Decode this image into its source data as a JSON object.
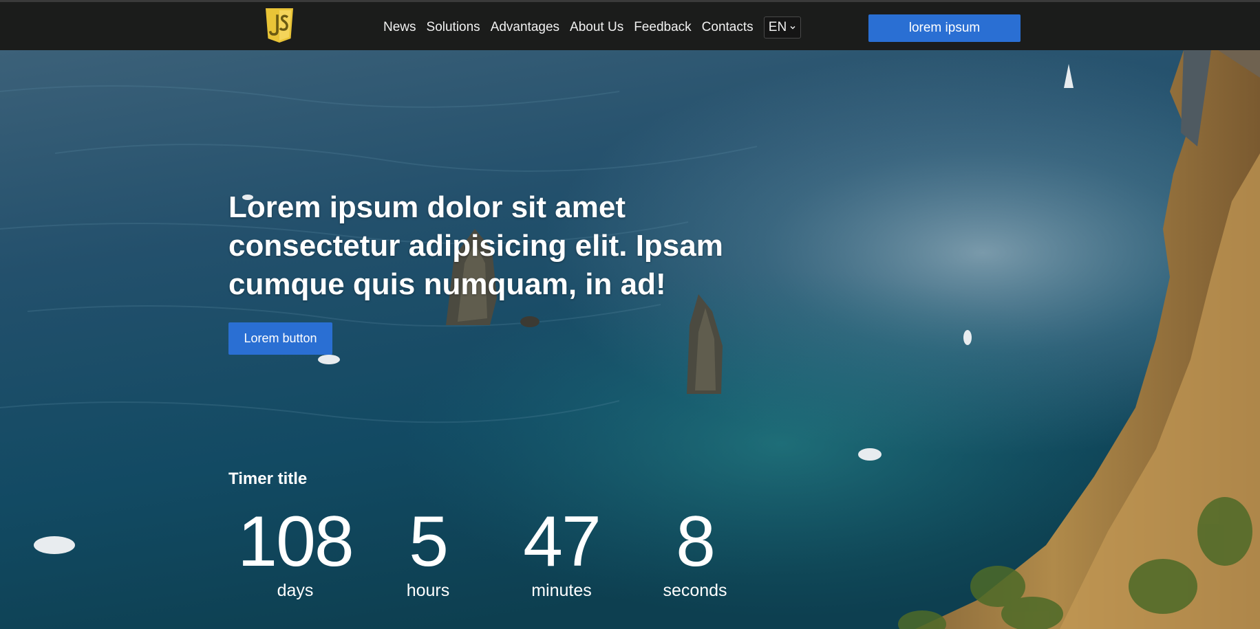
{
  "header": {
    "logo_text": "JS",
    "nav": [
      "News",
      "Solutions",
      "Advantages",
      "About Us",
      "Feedback",
      "Contacts"
    ],
    "language": "EN",
    "cta_label": "lorem ipsum"
  },
  "hero": {
    "headline": "Lorem ipsum dolor sit amet consectetur adipisicing elit. Ipsam cumque quis numquam, in ad!",
    "button_label": "Lorem button",
    "timer": {
      "title": "Timer title",
      "units": [
        {
          "value": "108",
          "label": "days"
        },
        {
          "value": "5",
          "label": "hours"
        },
        {
          "value": "47",
          "label": "minutes"
        },
        {
          "value": "8",
          "label": "seconds"
        }
      ]
    }
  },
  "colors": {
    "header_bg": "#1b1c1b",
    "accent_blue": "#2a6fd3",
    "logo_yellow": "#e9c437"
  },
  "icons": [
    "js-shield-logo-icon",
    "chevron-down-icon"
  ]
}
